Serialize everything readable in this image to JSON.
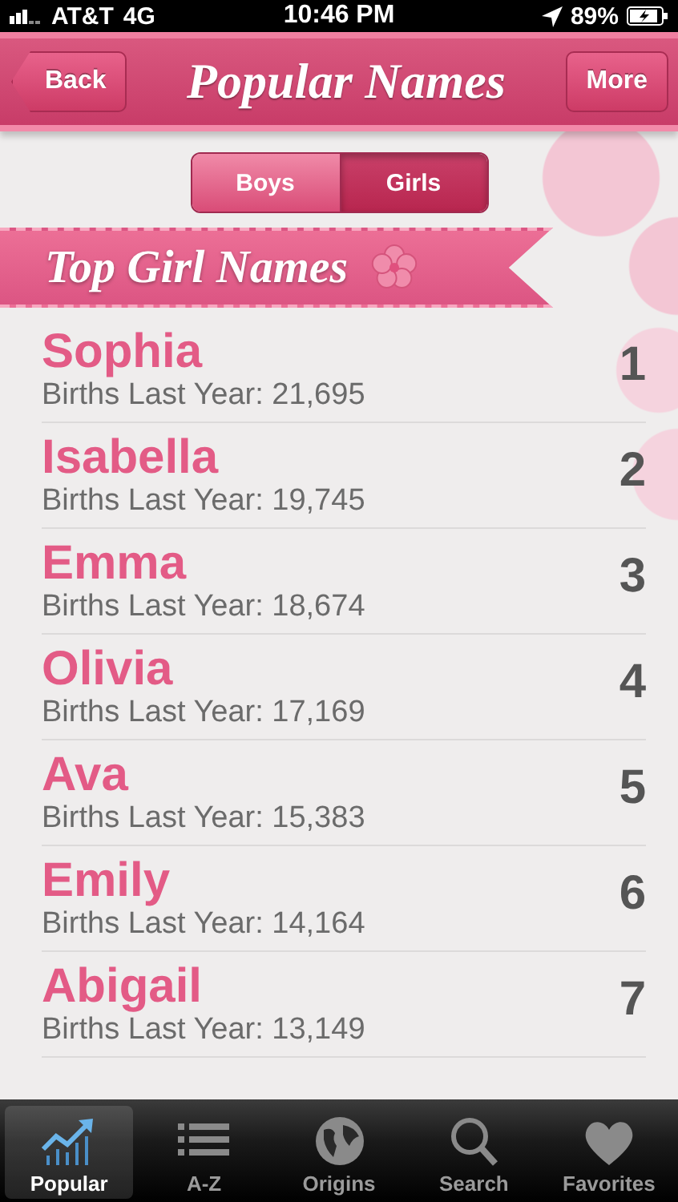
{
  "status_bar": {
    "carrier": "AT&T",
    "network": "4G",
    "time": "10:46 PM",
    "battery": "89%"
  },
  "nav_bar": {
    "back": "Back",
    "title": "Popular Names",
    "more": "More"
  },
  "segments": [
    {
      "label": "Boys",
      "selected": false
    },
    {
      "label": "Girls",
      "selected": true
    }
  ],
  "section_title": "Top Girl Names",
  "names": [
    {
      "name": "Sophia",
      "births": "Births Last Year: 21,695",
      "rank": "1"
    },
    {
      "name": "Isabella",
      "births": "Births Last Year: 19,745",
      "rank": "2"
    },
    {
      "name": "Emma",
      "births": "Births Last Year: 18,674",
      "rank": "3"
    },
    {
      "name": "Olivia",
      "births": "Births Last Year: 17,169",
      "rank": "4"
    },
    {
      "name": "Ava",
      "births": "Births Last Year: 15,383",
      "rank": "5"
    },
    {
      "name": "Emily",
      "births": "Births Last Year: 14,164",
      "rank": "6"
    },
    {
      "name": "Abigail",
      "births": "Births Last Year: 13,149",
      "rank": "7"
    }
  ],
  "tab_bar": [
    {
      "label": "Popular",
      "kind": "chart",
      "selected": true
    },
    {
      "label": "A-Z",
      "kind": "list",
      "selected": false
    },
    {
      "label": "Origins",
      "kind": "globe",
      "selected": false
    },
    {
      "label": "Search",
      "kind": "search",
      "selected": false
    },
    {
      "label": "Favorites",
      "kind": "heart",
      "selected": false
    }
  ]
}
